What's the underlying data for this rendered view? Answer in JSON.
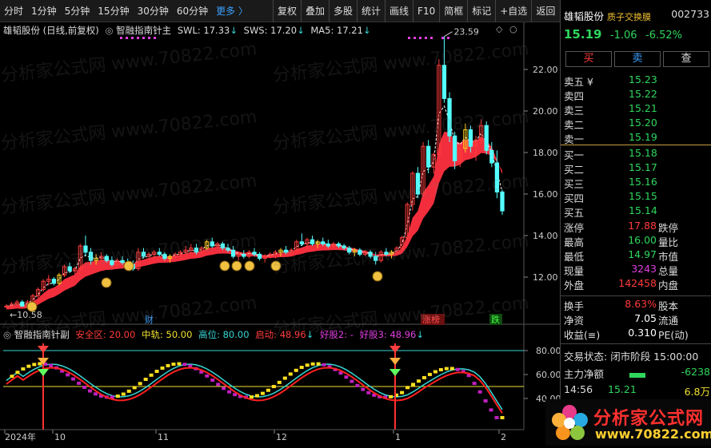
{
  "toolbar": {
    "periods": [
      "分时",
      "1分钟",
      "5分钟",
      "15分钟",
      "30分钟",
      "60分钟"
    ],
    "more": "更多 〉",
    "tools": [
      "复权",
      "叠加",
      "多股",
      "统计",
      "画线",
      "F10",
      "简框",
      "标记",
      "+自选",
      "返回"
    ]
  },
  "main_title": {
    "stock": "雄韬股份 (日线,前复权)",
    "indicator": "智融指南针主",
    "swl": "SWL: 17.33",
    "sws": "SWS: 17.20",
    "ma5": "MA5: 17.21"
  },
  "sub_title": {
    "indicator": "智融指南针副",
    "safe": "安全区: 20.00",
    "mid": "中轨: 50.00",
    "high": "高位: 80.00",
    "start": "启动: 48.96",
    "good2": "好股2: -",
    "good3": "好股3: 48.96"
  },
  "markers": {
    "cai": "财",
    "zhangbang": "涨榜",
    "die": "跌"
  },
  "watermark": "分析家公式网 www.70822.com",
  "logo": {
    "text": "分析家公式网",
    "url": "www.70822.com"
  },
  "quote": {
    "name": "雄韬股份",
    "tag": "质子交换膜",
    "code": "002733",
    "price": "15.19",
    "change": "-1.06",
    "pct": "-6.52%",
    "buttons": [
      "买",
      "卖",
      "查"
    ],
    "asks": [
      {
        "label": "卖五 ¥",
        "price": "15.23"
      },
      {
        "label": "卖四",
        "price": "15.22"
      },
      {
        "label": "卖三",
        "price": "15.21"
      },
      {
        "label": "卖二",
        "price": "15.20"
      },
      {
        "label": "卖一",
        "price": "15.19"
      }
    ],
    "bids": [
      {
        "label": "买一",
        "price": "15.18"
      },
      {
        "label": "买二",
        "price": "15.17"
      },
      {
        "label": "买三",
        "price": "15.16"
      },
      {
        "label": "买四",
        "price": "15.15"
      },
      {
        "label": "买五",
        "price": "15.14"
      }
    ],
    "stats": [
      {
        "l1": "涨停",
        "v1": "17.88",
        "l2": "跌停"
      },
      {
        "l1": "最高",
        "v1": "16.00",
        "l2": "量比"
      },
      {
        "l1": "最低",
        "v1": "14.97",
        "l2": "市值"
      },
      {
        "l1": "现量",
        "v1": "3243",
        "l2": "总量"
      },
      {
        "l1": "外盘",
        "v1": "142458",
        "l2": "内盘"
      }
    ],
    "turnover": [
      {
        "l1": "换手",
        "v1": "8.63%",
        "l2": "股本"
      },
      {
        "l1": "净资",
        "v1": "7.05",
        "l2": "流通"
      },
      {
        "l1": "收益(≡)",
        "v1": "0.310",
        "l2": "PE(动)"
      }
    ],
    "status_label": "交易状态:",
    "status_value": "闭市阶段 15:00:00",
    "net_flow_label": "主力净额",
    "net_flow_value": "-6238",
    "tick": {
      "time": "14:56",
      "price": "15.21",
      "vol": "6.8万"
    }
  },
  "chart_data": [
    {
      "type": "candlestick",
      "title": "雄韬股份 (日线,前复权)",
      "ylim": [
        10,
        24
      ],
      "yticks": [
        12,
        14,
        16,
        18,
        20,
        22
      ],
      "xticks": [
        "2024年",
        "10",
        "11",
        "12",
        "1",
        "2"
      ],
      "annotations": {
        "high": "23.59",
        "low": "10.58"
      },
      "series_labels": {
        "swl": 17.33,
        "sws": 17.2,
        "ma5": 17.21
      },
      "ohlc": [
        [
          10.6,
          10.7,
          10.5,
          10.6
        ],
        [
          10.6,
          10.8,
          10.5,
          10.7
        ],
        [
          10.7,
          10.9,
          10.6,
          10.8
        ],
        [
          10.8,
          10.9,
          10.6,
          10.6
        ],
        [
          10.6,
          10.9,
          10.58,
          10.8
        ],
        [
          10.8,
          11.2,
          10.7,
          11.1
        ],
        [
          11.1,
          11.5,
          11.0,
          11.4
        ],
        [
          11.4,
          11.9,
          11.3,
          11.8
        ],
        [
          11.8,
          12.1,
          11.6,
          11.9
        ],
        [
          11.9,
          12.0,
          11.6,
          11.7
        ],
        [
          11.7,
          12.2,
          11.6,
          12.1
        ],
        [
          12.1,
          12.6,
          12.0,
          12.5
        ],
        [
          12.5,
          12.7,
          12.2,
          12.3
        ],
        [
          12.3,
          12.5,
          12.1,
          12.4
        ],
        [
          12.4,
          13.6,
          12.3,
          13.5
        ],
        [
          13.5,
          14.0,
          13.0,
          13.2
        ],
        [
          13.2,
          13.4,
          12.6,
          12.8
        ],
        [
          12.8,
          13.1,
          12.6,
          12.9
        ],
        [
          12.9,
          13.2,
          12.7,
          13.0
        ],
        [
          13.0,
          13.1,
          12.7,
          12.8
        ],
        [
          12.8,
          13.0,
          12.5,
          12.6
        ],
        [
          12.6,
          12.9,
          12.4,
          12.8
        ],
        [
          12.8,
          13.0,
          12.6,
          12.7
        ],
        [
          12.7,
          12.9,
          12.5,
          12.6
        ],
        [
          12.6,
          12.8,
          12.3,
          12.4
        ],
        [
          12.4,
          13.4,
          12.3,
          13.2
        ],
        [
          13.2,
          13.4,
          12.9,
          13.0
        ],
        [
          13.0,
          13.2,
          12.8,
          13.1
        ],
        [
          13.1,
          13.3,
          12.9,
          13.2
        ],
        [
          13.2,
          13.4,
          13.0,
          13.1
        ],
        [
          13.1,
          13.2,
          12.8,
          12.9
        ],
        [
          12.9,
          13.1,
          12.7,
          13.0
        ],
        [
          13.0,
          13.2,
          12.9,
          13.1
        ],
        [
          13.1,
          13.3,
          12.9,
          13.2
        ],
        [
          13.2,
          13.5,
          13.0,
          13.3
        ],
        [
          13.3,
          13.6,
          13.1,
          13.4
        ],
        [
          13.4,
          13.6,
          13.1,
          13.2
        ],
        [
          13.2,
          13.5,
          13.1,
          13.4
        ],
        [
          13.4,
          13.8,
          13.3,
          13.7
        ],
        [
          13.7,
          13.9,
          13.4,
          13.5
        ],
        [
          13.5,
          13.7,
          13.4,
          13.6
        ],
        [
          13.6,
          13.7,
          13.3,
          13.4
        ],
        [
          13.4,
          13.6,
          13.2,
          13.3
        ],
        [
          13.3,
          13.5,
          12.9,
          13.0
        ],
        [
          13.0,
          13.2,
          12.8,
          13.1
        ],
        [
          13.1,
          13.3,
          12.9,
          13.0
        ],
        [
          13.0,
          13.3,
          12.9,
          13.2
        ],
        [
          13.2,
          13.4,
          13.0,
          13.1
        ],
        [
          13.1,
          13.2,
          12.8,
          12.9
        ],
        [
          12.9,
          13.1,
          12.7,
          13.0
        ],
        [
          13.0,
          13.2,
          12.9,
          13.1
        ],
        [
          13.1,
          13.3,
          12.9,
          13.2
        ],
        [
          13.2,
          13.4,
          13.0,
          13.3
        ],
        [
          13.3,
          13.5,
          13.1,
          13.2
        ],
        [
          13.2,
          13.4,
          13.0,
          13.3
        ],
        [
          13.3,
          13.8,
          13.2,
          13.7
        ],
        [
          13.7,
          14.1,
          13.5,
          13.6
        ],
        [
          13.6,
          13.9,
          13.4,
          13.8
        ],
        [
          13.8,
          14.0,
          13.5,
          13.6
        ],
        [
          13.6,
          13.8,
          13.4,
          13.7
        ],
        [
          13.7,
          13.9,
          13.5,
          13.6
        ],
        [
          13.6,
          13.8,
          13.4,
          13.5
        ],
        [
          13.5,
          13.7,
          13.4,
          13.6
        ],
        [
          13.6,
          13.7,
          13.4,
          13.5
        ],
        [
          13.5,
          13.6,
          13.3,
          13.4
        ],
        [
          13.4,
          13.5,
          13.1,
          13.2
        ],
        [
          13.2,
          13.4,
          13.0,
          13.3
        ],
        [
          13.3,
          13.4,
          13.0,
          13.1
        ],
        [
          13.1,
          13.3,
          13.0,
          13.2
        ],
        [
          13.2,
          13.3,
          12.9,
          13.0
        ],
        [
          13.0,
          13.2,
          12.6,
          12.8
        ],
        [
          12.8,
          13.3,
          12.7,
          13.2
        ],
        [
          13.2,
          13.4,
          13.0,
          13.1
        ],
        [
          13.1,
          13.3,
          12.9,
          13.2
        ],
        [
          13.2,
          13.5,
          13.1,
          13.4
        ],
        [
          13.4,
          14.0,
          13.3,
          13.9
        ],
        [
          13.9,
          15.6,
          13.8,
          15.5
        ],
        [
          15.5,
          17.1,
          15.2,
          17.0
        ],
        [
          17.0,
          17.3,
          15.8,
          16.0
        ],
        [
          16.0,
          18.5,
          15.9,
          18.3
        ],
        [
          18.3,
          18.6,
          17.0,
          17.3
        ],
        [
          17.3,
          18.0,
          17.0,
          17.9
        ],
        [
          17.9,
          22.5,
          17.8,
          22.2
        ],
        [
          22.2,
          23.59,
          20.4,
          20.6
        ],
        [
          20.6,
          20.9,
          18.5,
          18.8
        ],
        [
          18.8,
          19.0,
          17.2,
          17.6
        ],
        [
          17.6,
          18.4,
          17.3,
          18.2
        ],
        [
          18.2,
          19.4,
          18.0,
          19.1
        ],
        [
          19.1,
          19.3,
          18.0,
          18.3
        ],
        [
          18.3,
          18.8,
          17.6,
          18.6
        ],
        [
          18.6,
          19.6,
          18.4,
          19.3
        ],
        [
          19.3,
          19.5,
          17.9,
          18.1
        ],
        [
          18.1,
          18.5,
          17.3,
          17.5
        ],
        [
          17.5,
          18.1,
          15.8,
          16.1
        ],
        [
          16.1,
          16.2,
          15.0,
          15.19
        ]
      ]
    },
    {
      "type": "line",
      "title": "智融指南针副",
      "ylim": [
        20,
        90
      ],
      "yticks": [
        40,
        60,
        80
      ],
      "reference_lines": {
        "safe": 20.0,
        "mid": 50.0,
        "high": 80.0
      },
      "series": [
        {
          "name": "启动",
          "values": [
            48.96
          ]
        },
        {
          "name": "好股3",
          "values": [
            48.96
          ]
        }
      ]
    }
  ]
}
